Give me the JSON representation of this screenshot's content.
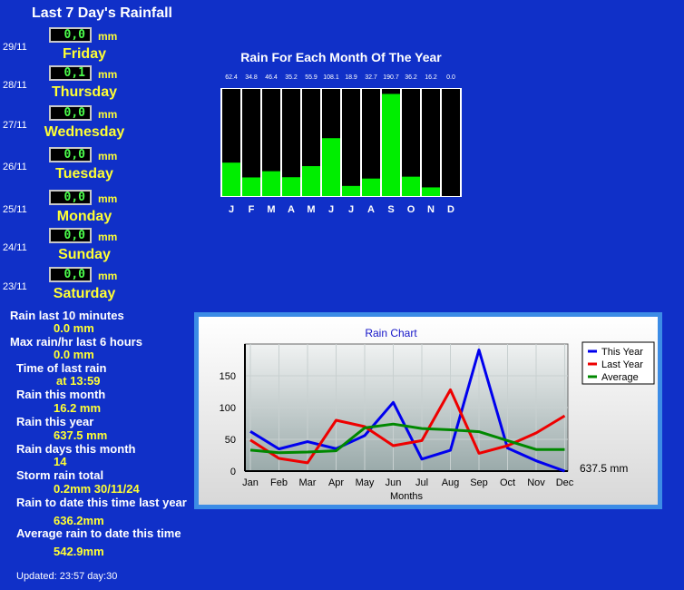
{
  "header": {
    "title": "Last 7 Day's Rainfall"
  },
  "unit_mm": "mm",
  "days": [
    {
      "date": "29/11",
      "value": "0,0",
      "day": "Friday"
    },
    {
      "date": "28/11",
      "value": "0,1",
      "day": "Thursday"
    },
    {
      "date": "27/11",
      "value": "0,0",
      "day": "Wednesday"
    },
    {
      "date": "26/11",
      "value": "0,0",
      "day": "Tuesday"
    },
    {
      "date": "25/11",
      "value": "0,0",
      "day": "Monday"
    },
    {
      "date": "24/11",
      "value": "0,0",
      "day": "Sunday"
    },
    {
      "date": "23/11",
      "value": "0,0",
      "day": "Saturday"
    }
  ],
  "stats": [
    {
      "label": "Rain last 10 minutes",
      "value": "0.0 mm"
    },
    {
      "label": "Max rain/hr last 6 hours",
      "value": "0.0 mm"
    },
    {
      "label": "Time of last rain",
      "value": "at 13:59"
    },
    {
      "label": "Rain this month",
      "value": "16.2 mm"
    },
    {
      "label": "Rain this year",
      "value": "637.5 mm"
    },
    {
      "label": "Rain days this month",
      "value": "14"
    },
    {
      "label": "Storm rain total",
      "value": "0.2mm 30/11/24"
    },
    {
      "label": "Rain to date this time last year",
      "value": "636.2mm"
    },
    {
      "label": "Average rain to date this time",
      "value": "542.9mm"
    }
  ],
  "footer": {
    "updated": "Updated: 23:57 day:30"
  },
  "chart_data": [
    {
      "type": "bar",
      "title": "Rain For Each Month Of The Year",
      "categories": [
        "J",
        "F",
        "M",
        "A",
        "M",
        "J",
        "J",
        "A",
        "S",
        "O",
        "N",
        "D"
      ],
      "values": [
        62.4,
        34.8,
        46.4,
        35.2,
        55.9,
        108.1,
        18.9,
        32.7,
        190.7,
        36.2,
        16.2,
        0.0
      ],
      "value_labels": [
        "62.4",
        "34.8",
        "46.4",
        "35.2",
        "55.9",
        "108.1",
        "18.9",
        "32.7",
        "190.7",
        "36.2",
        "16.2",
        "0.0"
      ],
      "ylim": [
        0,
        200
      ],
      "colors": {
        "bar": "#00ee00",
        "background": "#000000",
        "border": "#ffffff"
      }
    },
    {
      "type": "line",
      "title": "Rain Chart",
      "xlabel": "Months",
      "ylabel": "",
      "categories": [
        "Jan",
        "Feb",
        "Mar",
        "Apr",
        "May",
        "Jun",
        "Jul",
        "Aug",
        "Sep",
        "Oct",
        "Nov",
        "Dec"
      ],
      "ylim": [
        0,
        200
      ],
      "yticks": [
        "0",
        "50",
        "100",
        "150"
      ],
      "series": [
        {
          "name": "This Year",
          "color": "#0000ee",
          "values": [
            62.4,
            34.8,
            46.4,
            35.2,
            55.9,
            108.1,
            18.9,
            32.7,
            190.7,
            36.2,
            16.2,
            0.0
          ]
        },
        {
          "name": "Last Year",
          "color": "#ee0000",
          "values": [
            49,
            20,
            13,
            80,
            70,
            40,
            48,
            128,
            28,
            40,
            60,
            87
          ]
        },
        {
          "name": "Average",
          "color": "#008800",
          "values": [
            33,
            29,
            30,
            32,
            68,
            74,
            67,
            65,
            62,
            48,
            34,
            34
          ]
        }
      ],
      "legend": "top-right",
      "total_label": "637.5 mm"
    }
  ]
}
